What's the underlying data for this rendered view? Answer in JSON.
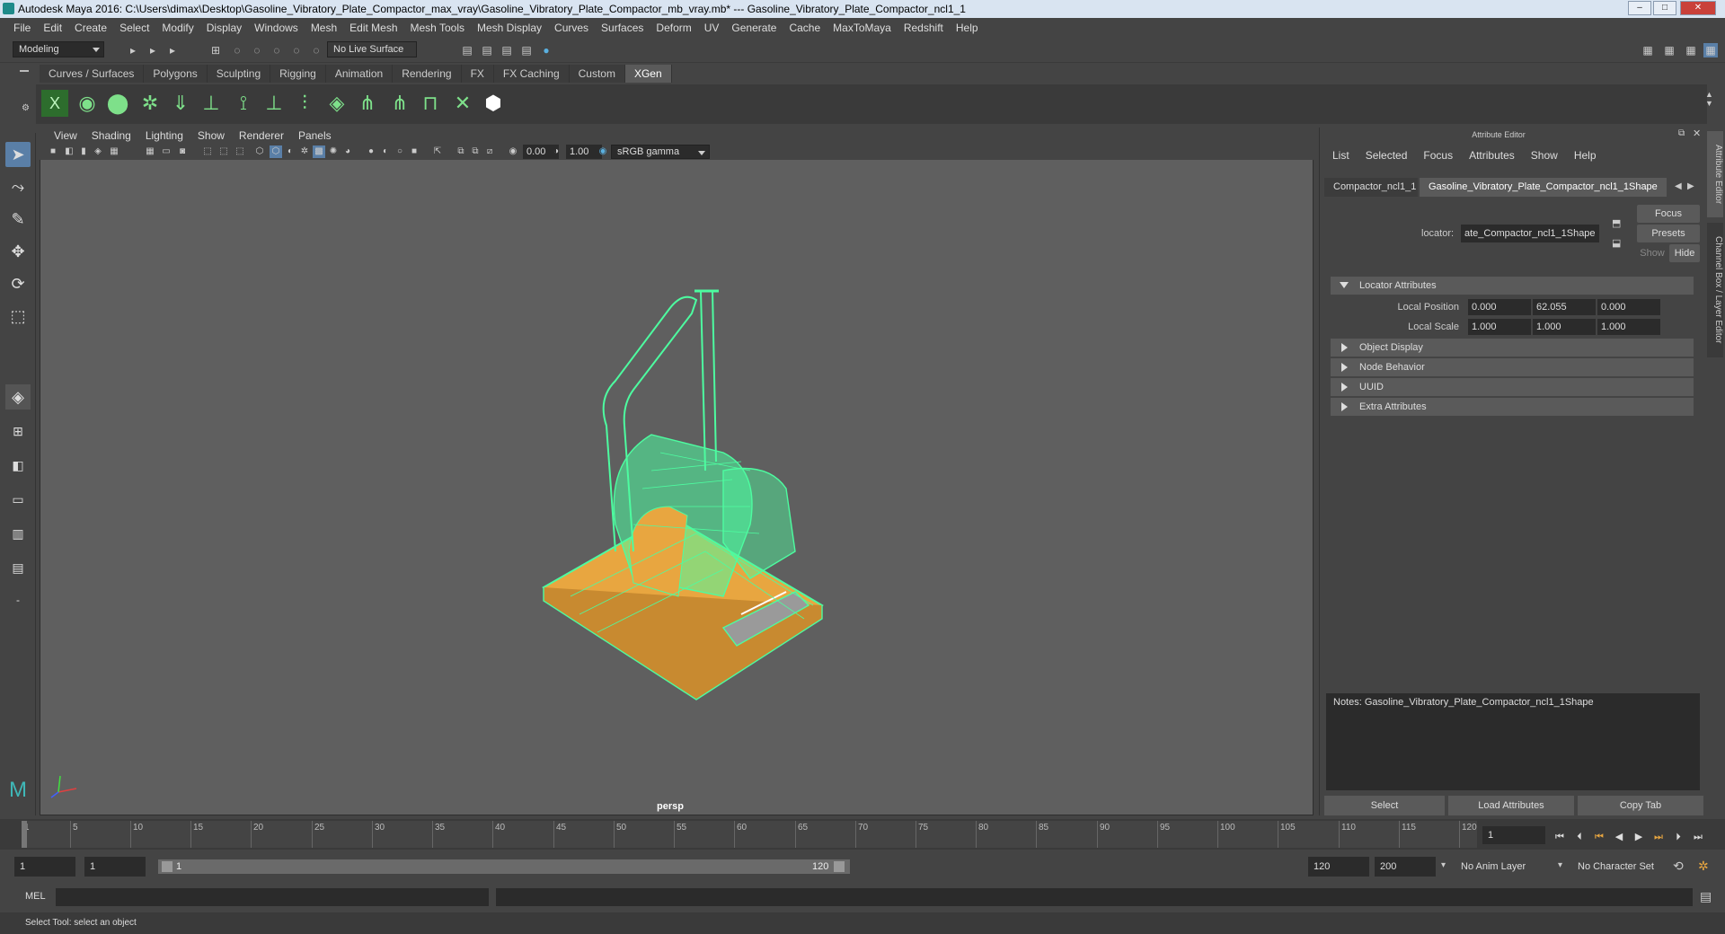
{
  "window": {
    "title": "Autodesk Maya 2016: C:\\Users\\dimax\\Desktop\\Gasoline_Vibratory_Plate_Compactor_max_vray\\Gasoline_Vibratory_Plate_Compactor_mb_vray.mb*  ---  Gasoline_Vibratory_Plate_Compactor_ncl1_1"
  },
  "menubar": [
    "File",
    "Edit",
    "Create",
    "Select",
    "Modify",
    "Display",
    "Windows",
    "Mesh",
    "Edit Mesh",
    "Mesh Tools",
    "Mesh Display",
    "Curves",
    "Surfaces",
    "Deform",
    "UV",
    "Generate",
    "Cache",
    "MaxToMaya",
    "Redshift",
    "Help"
  ],
  "status": {
    "mode": "Modeling",
    "live_surface": "No Live Surface"
  },
  "shelf_tabs": [
    "Curves / Surfaces",
    "Polygons",
    "Sculpting",
    "Rigging",
    "Animation",
    "Rendering",
    "FX",
    "FX Caching",
    "Custom",
    "XGen"
  ],
  "shelf_active": "XGen",
  "viewport": {
    "menus": [
      "View",
      "Shading",
      "Lighting",
      "Show",
      "Renderer",
      "Panels"
    ],
    "exposure": "0.00",
    "gamma": "1.00",
    "colorspace": "sRGB gamma",
    "camera_label": "persp"
  },
  "attribute_editor": {
    "title": "Attribute Editor",
    "menus": [
      "List",
      "Selected",
      "Focus",
      "Attributes",
      "Show",
      "Help"
    ],
    "tab_left": "Compactor_ncl1_1",
    "tab_active": "Gasoline_Vibratory_Plate_Compactor_ncl1_1Shape",
    "locator_label": "locator:",
    "locator_value": "ate_Compactor_ncl1_1Shape",
    "focus": "Focus",
    "presets": "Presets",
    "show": "Show",
    "hide": "Hide",
    "sections": [
      "Locator Attributes",
      "Object Display",
      "Node Behavior",
      "UUID",
      "Extra Attributes"
    ],
    "local_position_label": "Local Position",
    "local_position": [
      "0.000",
      "62.055",
      "0.000"
    ],
    "local_scale_label": "Local Scale",
    "local_scale": [
      "1.000",
      "1.000",
      "1.000"
    ],
    "notes": "Notes:  Gasoline_Vibratory_Plate_Compactor_ncl1_1Shape",
    "buttons": [
      "Select",
      "Load Attributes",
      "Copy Tab"
    ]
  },
  "side_tabs": [
    "Attribute Editor",
    "Channel Box / Layer Editor"
  ],
  "timeline": {
    "ticks": [
      "1",
      "5",
      "10",
      "15",
      "20",
      "25",
      "30",
      "35",
      "40",
      "45",
      "50",
      "55",
      "60",
      "65",
      "70",
      "75",
      "80",
      "85",
      "90",
      "95",
      "100",
      "105",
      "110",
      "115",
      "120"
    ],
    "current_frame": "1"
  },
  "range": {
    "start": "1",
    "start2": "1",
    "slider_start": "1",
    "slider_end": "120",
    "end": "120",
    "end2": "200",
    "anim_layer": "No Anim Layer",
    "char_set": "No Character Set"
  },
  "cmd": {
    "label": "MEL"
  },
  "help_line": "Select Tool: select an object",
  "colors": {
    "wire": "#4dfca0",
    "body": "#e8a640",
    "accent": "#5a7fa7"
  }
}
